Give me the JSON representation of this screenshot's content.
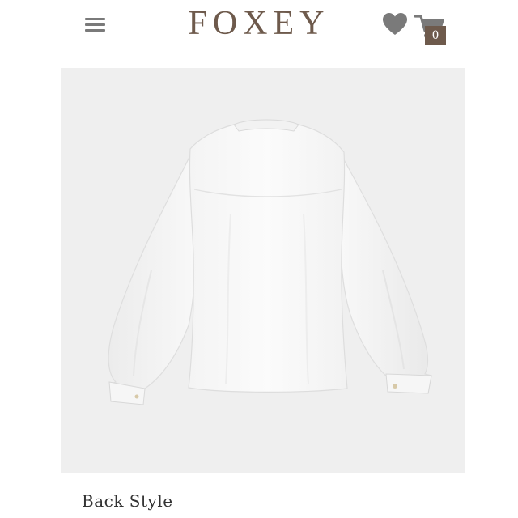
{
  "header": {
    "brand": "FOXEY",
    "menu_icon": "hamburger-menu-icon",
    "wishlist_icon": "heart-icon",
    "cart_icon": "shopping-cart-icon",
    "cart_count": "0"
  },
  "product": {
    "image_subject": "white blouse back view",
    "caption": "Back Style"
  },
  "colors": {
    "brand": "#6e5a4c",
    "icon_gray": "#7a7a7a",
    "image_background": "#efefef"
  }
}
